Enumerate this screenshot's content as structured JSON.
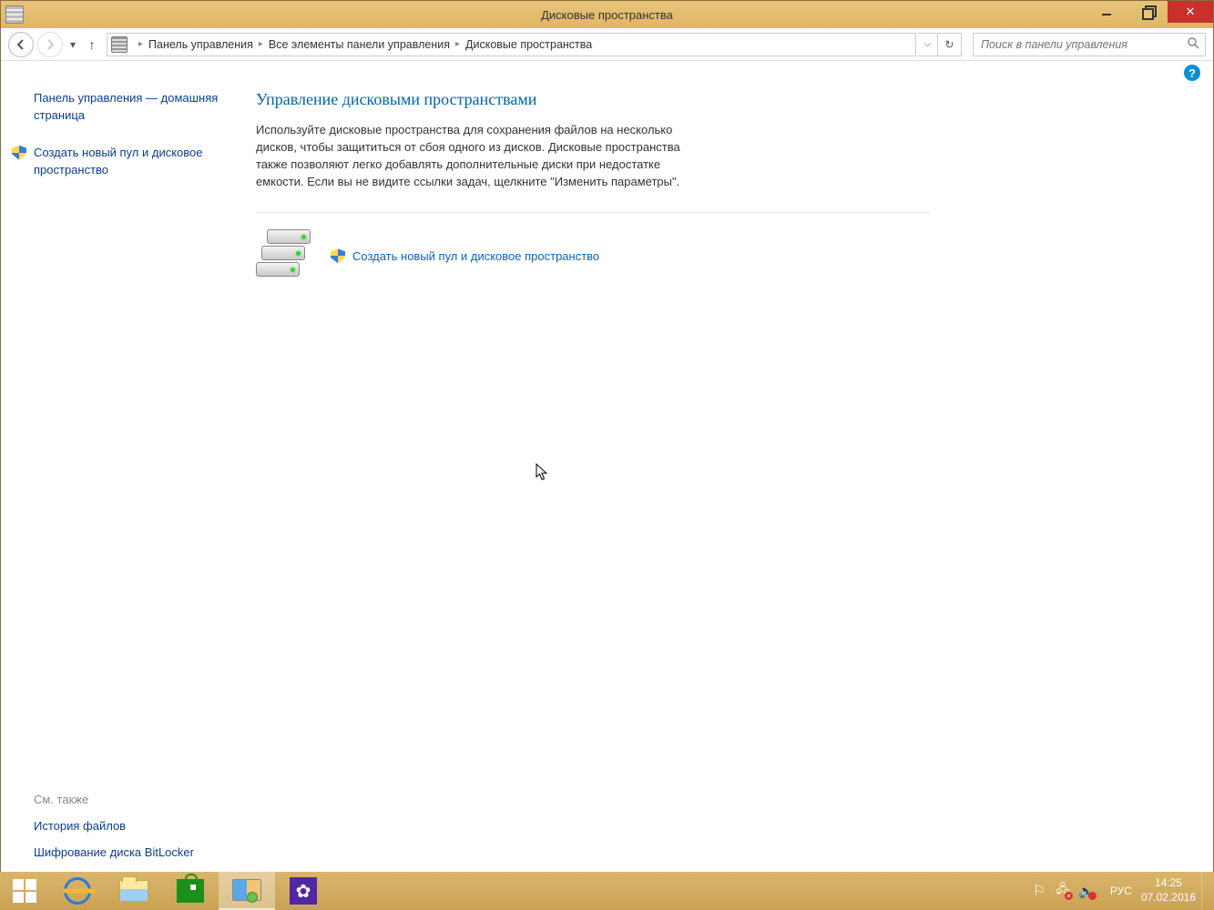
{
  "window": {
    "title": "Дисковые пространства"
  },
  "breadcrumb": {
    "items": [
      "Панель управления",
      "Все элементы панели управления",
      "Дисковые пространства"
    ]
  },
  "search": {
    "placeholder": "Поиск в панели управления"
  },
  "sidebar": {
    "home_link": "Панель управления — домашняя страница",
    "create_link": "Создать новый пул и дисковое пространство",
    "see_also_title": "См. также",
    "see_also": [
      "История файлов",
      "Шифрование диска BitLocker"
    ]
  },
  "main": {
    "title": "Управление дисковыми пространствами",
    "description": "Используйте дисковые пространства для сохранения файлов на несколько дисков, чтобы защититься от сбоя одного из дисков. Дисковые пространства также позволяют легко добавлять дополнительные диски при недостатке емкости. Если вы не видите ссылки задач, щелкните \"Изменить параметры\".",
    "action_link": "Создать новый пул и дисковое пространство"
  },
  "tray": {
    "lang": "РУС",
    "time": "14:25",
    "date": "07.02.2016"
  }
}
